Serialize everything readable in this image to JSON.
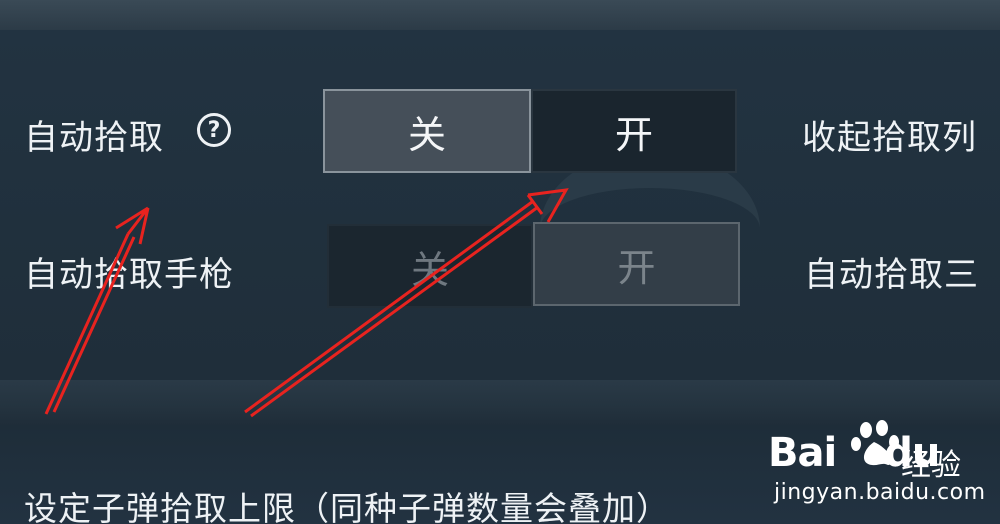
{
  "settings": {
    "auto_pickup": {
      "label": "自动拾取",
      "help_glyph": "?",
      "off_label": "关",
      "on_label": "开",
      "selected": "off"
    },
    "auto_pickup_pistol": {
      "label": "自动拾取手枪",
      "off_label": "关",
      "on_label": "开",
      "disabled": true
    },
    "collapse_pickup_list": {
      "label": "收起拾取列"
    },
    "auto_pickup_three": {
      "label": "自动拾取三"
    },
    "ammo_limit": {
      "label": "设定子弹拾取上限（同种子弹数量会叠加）"
    }
  },
  "annotations": {
    "arrow_color": "#e8231f"
  },
  "watermark": {
    "brand": "Bai",
    "brand_suffix": "du",
    "brand_cn": "经验",
    "url": "jingyan.baidu.com"
  },
  "colors": {
    "background": "#1f2e3a",
    "text": "#eef2f5",
    "segment_selected": "#454f59",
    "segment_unselected": "#1a252e"
  },
  "icons": {
    "help": "question-circle-icon",
    "watermark_logo": "baidu-paw-icon"
  }
}
